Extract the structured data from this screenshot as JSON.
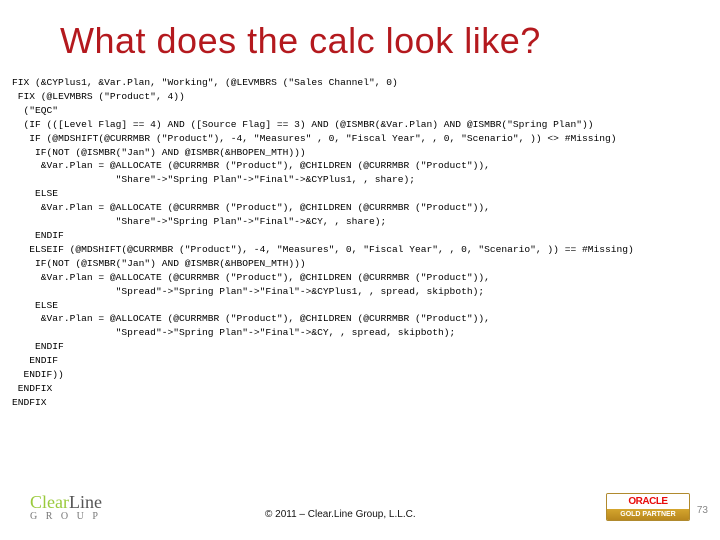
{
  "title": "What does the calc look like?",
  "code": "FIX (&CYPlus1, &Var.Plan, \"Working\", (@LEVMBRS (\"Sales Channel\", 0)\n FIX (@LEVMBRS (\"Product\", 4))\n  (\"EQC\"\n  (IF (([Level Flag] == 4) AND ([Source Flag] == 3) AND (@ISMBR(&Var.Plan) AND @ISMBR(\"Spring Plan\"))\n   IF (@MDSHIFT(@CURRMBR (\"Product\"), -4, \"Measures\" , 0, \"Fiscal Year\", , 0, \"Scenario\", )) <> #Missing)\n    IF(NOT (@ISMBR(\"Jan\") AND @ISMBR(&HBOPEN_MTH)))\n     &Var.Plan = @ALLOCATE (@CURRMBR (\"Product\"), @CHILDREN (@CURRMBR (\"Product\")),\n                  \"Share\"->\"Spring Plan\"->\"Final\"->&CYPlus1, , share);\n    ELSE\n     &Var.Plan = @ALLOCATE (@CURRMBR (\"Product\"), @CHILDREN (@CURRMBR (\"Product\")),\n                  \"Share\"->\"Spring Plan\"->\"Final\"->&CY, , share);\n    ENDIF\n   ELSEIF (@MDSHIFT(@CURRMBR (\"Product\"), -4, \"Measures\", 0, \"Fiscal Year\", , 0, \"Scenario\", )) == #Missing)\n    IF(NOT (@ISMBR(\"Jan\") AND @ISMBR(&HBOPEN_MTH)))\n     &Var.Plan = @ALLOCATE (@CURRMBR (\"Product\"), @CHILDREN (@CURRMBR (\"Product\")),\n                  \"Spread\"->\"Spring Plan\"->\"Final\"->&CYPlus1, , spread, skipboth);\n    ELSE\n     &Var.Plan = @ALLOCATE (@CURRMBR (\"Product\"), @CHILDREN (@CURRMBR (\"Product\")),\n                  \"Spread\"->\"Spring Plan\"->\"Final\"->&CY, , spread, skipboth);\n    ENDIF\n   ENDIF\n  ENDIF))\n ENDFIX\nENDFIX",
  "logo": {
    "clear": "Clear",
    "line": "Line",
    "group": "G R O U P"
  },
  "copyright": "© 2011 – Clear.Line Group, L.L.C.",
  "oracle": {
    "top": "ORACLE",
    "bot": "GOLD PARTNER"
  },
  "page": "73"
}
